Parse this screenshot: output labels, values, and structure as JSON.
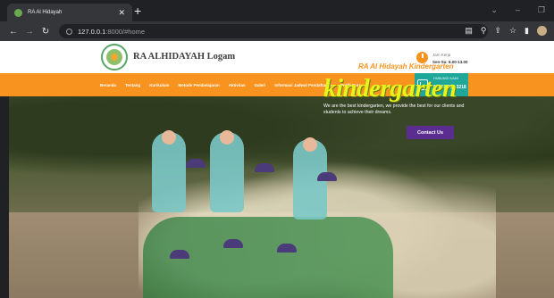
{
  "browser": {
    "tab_title": "RA Al Hidayah",
    "tab_close": "✕",
    "new_tab": "+",
    "url_host": "127.0.0.1",
    "url_rest": ":8000/#home",
    "nav": {
      "back": "←",
      "forward": "→",
      "reload": "↻"
    },
    "icons": [
      "read-later-icon",
      "search-icon",
      "share-icon",
      "bookmark-star-icon",
      "sidepanel-icon",
      "profile-avatar"
    ],
    "window_controls": {
      "collapse": "⌄",
      "minimize": "–",
      "restore": "❐"
    }
  },
  "site": {
    "name": "RA ALHIDAYAH Logam",
    "hours_label": "Jam Kerja",
    "hours_value": "Sen-Sa: 8.00-13.00",
    "nav_items": [
      "Beranda",
      "Tentang",
      "Kurikulum",
      "Metode Pembelajaran",
      "Aktivitas",
      "Galeri",
      "Informasi Jadwal Pendaftaran",
      "Profil Guru"
    ],
    "call_label": "HUBUNGI KAMI",
    "call_number": "0896-2200-3218"
  },
  "hero": {
    "subtitle": "RA Al Hidayah Kindergarten",
    "title": "kindergarten",
    "description": "We are the best kindergarten, we provide the best for our clients and students to achieve their dreams.",
    "contact_button": "Contact Us"
  },
  "colors": {
    "accent_orange": "#f7931e",
    "call_teal": "#1fa89a",
    "button_purple": "#5b2d91",
    "title_yellow": "#e6f51c"
  }
}
